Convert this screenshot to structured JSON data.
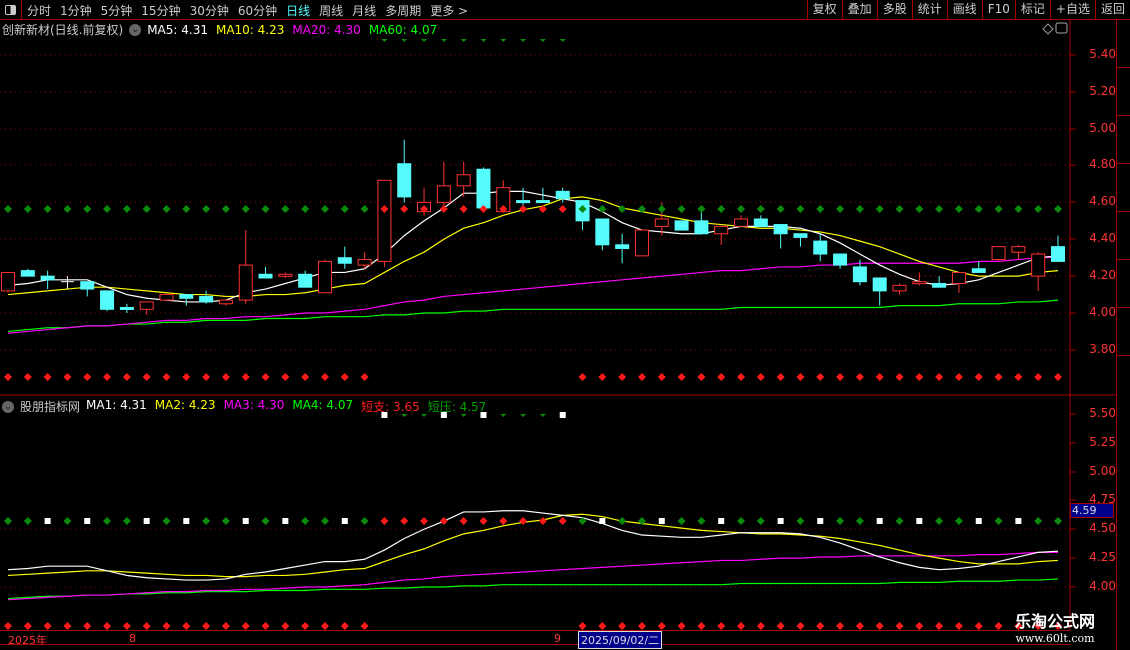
{
  "toolbar": {
    "periods": [
      "分时",
      "1分钟",
      "5分钟",
      "15分钟",
      "30分钟",
      "60分钟",
      "日线",
      "周线",
      "月线",
      "多周期",
      "更多 >"
    ],
    "active": "日线",
    "buttons": [
      "复权",
      "叠加",
      "多股",
      "统计",
      "画线",
      "F10",
      "标记",
      "+自选",
      "返回"
    ]
  },
  "main": {
    "title": "创新新材(日线.前复权)",
    "ma": [
      {
        "label": "MA5: 4.31",
        "color": "#ffffff"
      },
      {
        "label": "MA10: 4.23",
        "color": "#ffff00"
      },
      {
        "label": "MA20: 4.30",
        "color": "#ff00ff"
      },
      {
        "label": "MA60: 4.07",
        "color": "#00ff00"
      }
    ],
    "axis": [
      "5.40",
      "5.20",
      "5.00",
      "4.80",
      "4.60",
      "4.40",
      "4.20",
      "4.00",
      "3.80"
    ]
  },
  "sub": {
    "title": "股朋指标网",
    "ma": [
      {
        "label": "MA1: 4.31",
        "color": "#ffffff"
      },
      {
        "label": "MA2: 4.23",
        "color": "#ffff00"
      },
      {
        "label": "MA3: 4.30",
        "color": "#ff00ff"
      },
      {
        "label": "MA4: 4.07",
        "color": "#00ff00"
      },
      {
        "label": "短支: 3.65",
        "color": "#ff2020"
      },
      {
        "label": "短压: 4.57",
        "color": "#00a000"
      }
    ],
    "axis": [
      "5.50",
      "5.25",
      "5.00",
      "4.75",
      "4.50",
      "4.25",
      "4.00"
    ],
    "price_tag": "4.59"
  },
  "dates": {
    "year": "2025年",
    "m8": "8",
    "m9": "9",
    "cursor": "2025/09/02/二"
  },
  "watermark": {
    "name": "乐淘公式网",
    "url": "www.60lt.com"
  },
  "colors": {
    "up": "#ff3232",
    "down": "#54fcfc",
    "grid": "#900000"
  },
  "chart_data": {
    "type": "candlestick",
    "ylim_main": [
      3.7,
      5.5
    ],
    "ylim_sub": [
      3.9,
      5.55
    ],
    "ohlc": [
      [
        4.12,
        4.22,
        4.11,
        4.22
      ],
      [
        4.23,
        4.24,
        4.2,
        4.2
      ],
      [
        4.2,
        4.23,
        4.13,
        4.18
      ],
      [
        4.17,
        4.2,
        4.13,
        4.17
      ],
      [
        4.17,
        4.17,
        4.09,
        4.13
      ],
      [
        4.12,
        4.12,
        4.01,
        4.02
      ],
      [
        4.03,
        4.05,
        4.0,
        4.02
      ],
      [
        4.02,
        4.06,
        3.99,
        4.06
      ],
      [
        4.07,
        4.1,
        4.07,
        4.1
      ],
      [
        4.1,
        4.1,
        4.04,
        4.08
      ],
      [
        4.09,
        4.12,
        4.05,
        4.06
      ],
      [
        4.05,
        4.07,
        4.04,
        4.07
      ],
      [
        4.07,
        4.45,
        4.05,
        4.26
      ],
      [
        4.21,
        4.25,
        4.19,
        4.19
      ],
      [
        4.2,
        4.22,
        4.19,
        4.21
      ],
      [
        4.21,
        4.23,
        4.14,
        4.14
      ],
      [
        4.11,
        4.29,
        4.11,
        4.28
      ],
      [
        4.3,
        4.36,
        4.24,
        4.27
      ],
      [
        4.26,
        4.33,
        4.24,
        4.29
      ],
      [
        4.28,
        4.72,
        4.25,
        4.72
      ],
      [
        4.81,
        4.94,
        4.6,
        4.63
      ],
      [
        4.55,
        4.68,
        4.53,
        4.6
      ],
      [
        4.6,
        4.82,
        4.58,
        4.69
      ],
      [
        4.69,
        4.82,
        4.63,
        4.75
      ],
      [
        4.78,
        4.79,
        4.57,
        4.57
      ],
      [
        4.55,
        4.72,
        4.55,
        4.68
      ],
      [
        4.61,
        4.68,
        4.56,
        4.6
      ],
      [
        4.61,
        4.68,
        4.6,
        4.6
      ],
      [
        4.66,
        4.68,
        4.6,
        4.62
      ],
      [
        4.61,
        4.61,
        4.45,
        4.5
      ],
      [
        4.51,
        4.51,
        4.34,
        4.37
      ],
      [
        4.37,
        4.43,
        4.27,
        4.35
      ],
      [
        4.31,
        4.45,
        4.31,
        4.45
      ],
      [
        4.47,
        4.6,
        4.42,
        4.51
      ],
      [
        4.5,
        4.5,
        4.45,
        4.45
      ],
      [
        4.5,
        4.55,
        4.43,
        4.43
      ],
      [
        4.43,
        4.47,
        4.37,
        4.47
      ],
      [
        4.47,
        4.53,
        4.47,
        4.51
      ],
      [
        4.51,
        4.53,
        4.47,
        4.47
      ],
      [
        4.48,
        4.48,
        4.35,
        4.43
      ],
      [
        4.43,
        4.43,
        4.36,
        4.41
      ],
      [
        4.39,
        4.43,
        4.28,
        4.32
      ],
      [
        4.32,
        4.32,
        4.24,
        4.26
      ],
      [
        4.25,
        4.29,
        4.15,
        4.17
      ],
      [
        4.19,
        4.19,
        4.04,
        4.12
      ],
      [
        4.12,
        4.16,
        4.1,
        4.15
      ],
      [
        4.16,
        4.22,
        4.15,
        4.17
      ],
      [
        4.16,
        4.2,
        4.14,
        4.14
      ],
      [
        4.16,
        4.22,
        4.11,
        4.22
      ],
      [
        4.24,
        4.28,
        4.22,
        4.22
      ],
      [
        4.29,
        4.36,
        4.28,
        4.36
      ],
      [
        4.33,
        4.37,
        4.29,
        4.36
      ],
      [
        4.2,
        4.33,
        4.12,
        4.32
      ],
      [
        4.36,
        4.42,
        4.28,
        4.28
      ]
    ],
    "ma5": [
      4.15,
      4.16,
      4.18,
      4.18,
      4.18,
      4.14,
      4.1,
      4.08,
      4.07,
      4.06,
      4.06,
      4.07,
      4.11,
      4.13,
      4.16,
      4.19,
      4.22,
      4.22,
      4.24,
      4.32,
      4.42,
      4.5,
      4.57,
      4.65,
      4.65,
      4.66,
      4.66,
      4.64,
      4.62,
      4.6,
      4.55,
      4.49,
      4.45,
      4.44,
      4.43,
      4.43,
      4.45,
      4.47,
      4.47,
      4.47,
      4.46,
      4.43,
      4.38,
      4.32,
      4.26,
      4.21,
      4.17,
      4.15,
      4.16,
      4.18,
      4.22,
      4.26,
      4.3,
      4.31
    ],
    "ma10": [
      4.1,
      4.11,
      4.12,
      4.13,
      4.14,
      4.14,
      4.13,
      4.12,
      4.11,
      4.1,
      4.1,
      4.09,
      4.09,
      4.1,
      4.1,
      4.11,
      4.13,
      4.15,
      4.16,
      4.22,
      4.28,
      4.33,
      4.4,
      4.46,
      4.49,
      4.53,
      4.56,
      4.58,
      4.62,
      4.63,
      4.61,
      4.57,
      4.55,
      4.53,
      4.51,
      4.49,
      4.48,
      4.47,
      4.46,
      4.46,
      4.45,
      4.44,
      4.42,
      4.39,
      4.36,
      4.32,
      4.28,
      4.25,
      4.22,
      4.2,
      4.2,
      4.2,
      4.22,
      4.23
    ],
    "ma20": [
      3.89,
      3.9,
      3.91,
      3.92,
      3.93,
      3.93,
      3.94,
      3.95,
      3.96,
      3.96,
      3.97,
      3.97,
      3.98,
      3.98,
      3.99,
      4.0,
      4.0,
      4.01,
      4.02,
      4.04,
      4.06,
      4.07,
      4.09,
      4.1,
      4.11,
      4.12,
      4.13,
      4.14,
      4.15,
      4.16,
      4.17,
      4.18,
      4.19,
      4.2,
      4.21,
      4.22,
      4.23,
      4.23,
      4.24,
      4.25,
      4.25,
      4.26,
      4.26,
      4.27,
      4.27,
      4.27,
      4.27,
      4.27,
      4.27,
      4.28,
      4.28,
      4.29,
      4.3,
      4.3
    ],
    "ma60": [
      3.9,
      3.91,
      3.92,
      3.92,
      3.93,
      3.93,
      3.94,
      3.94,
      3.95,
      3.95,
      3.96,
      3.96,
      3.96,
      3.97,
      3.97,
      3.97,
      3.98,
      3.98,
      3.98,
      3.99,
      3.99,
      4.0,
      4.0,
      4.01,
      4.01,
      4.02,
      4.02,
      4.02,
      4.02,
      4.02,
      4.02,
      4.02,
      4.02,
      4.02,
      4.02,
      4.02,
      4.02,
      4.03,
      4.03,
      4.03,
      4.03,
      4.03,
      4.03,
      4.03,
      4.03,
      4.04,
      4.04,
      4.04,
      4.05,
      4.05,
      4.05,
      4.06,
      4.06,
      4.07
    ],
    "signals": {
      "main_top": "...................gggggggggg.........................",
      "main_mid": "gggggggggggggggggggrrrrrrrrrrggggggggggggggggggggggggg",
      "main_bot": "rrrrrrrrrrrrrrrrrrr..........rrrrrrrrrrrrrrrrrrrrrrrrr",
      "sub_top": "...................wggwgwgggw.........................",
      "sub_mid": "ggwgwggwgwggwgwggwgrrrrrrrrrrgwggwggwggwgwggwgwggwgwgg",
      "sub_bot": "rrrrrrrrrrrrrrrrrrr..........rrrrrrrrrrrrrrrrrrrrrrrrr"
    }
  }
}
